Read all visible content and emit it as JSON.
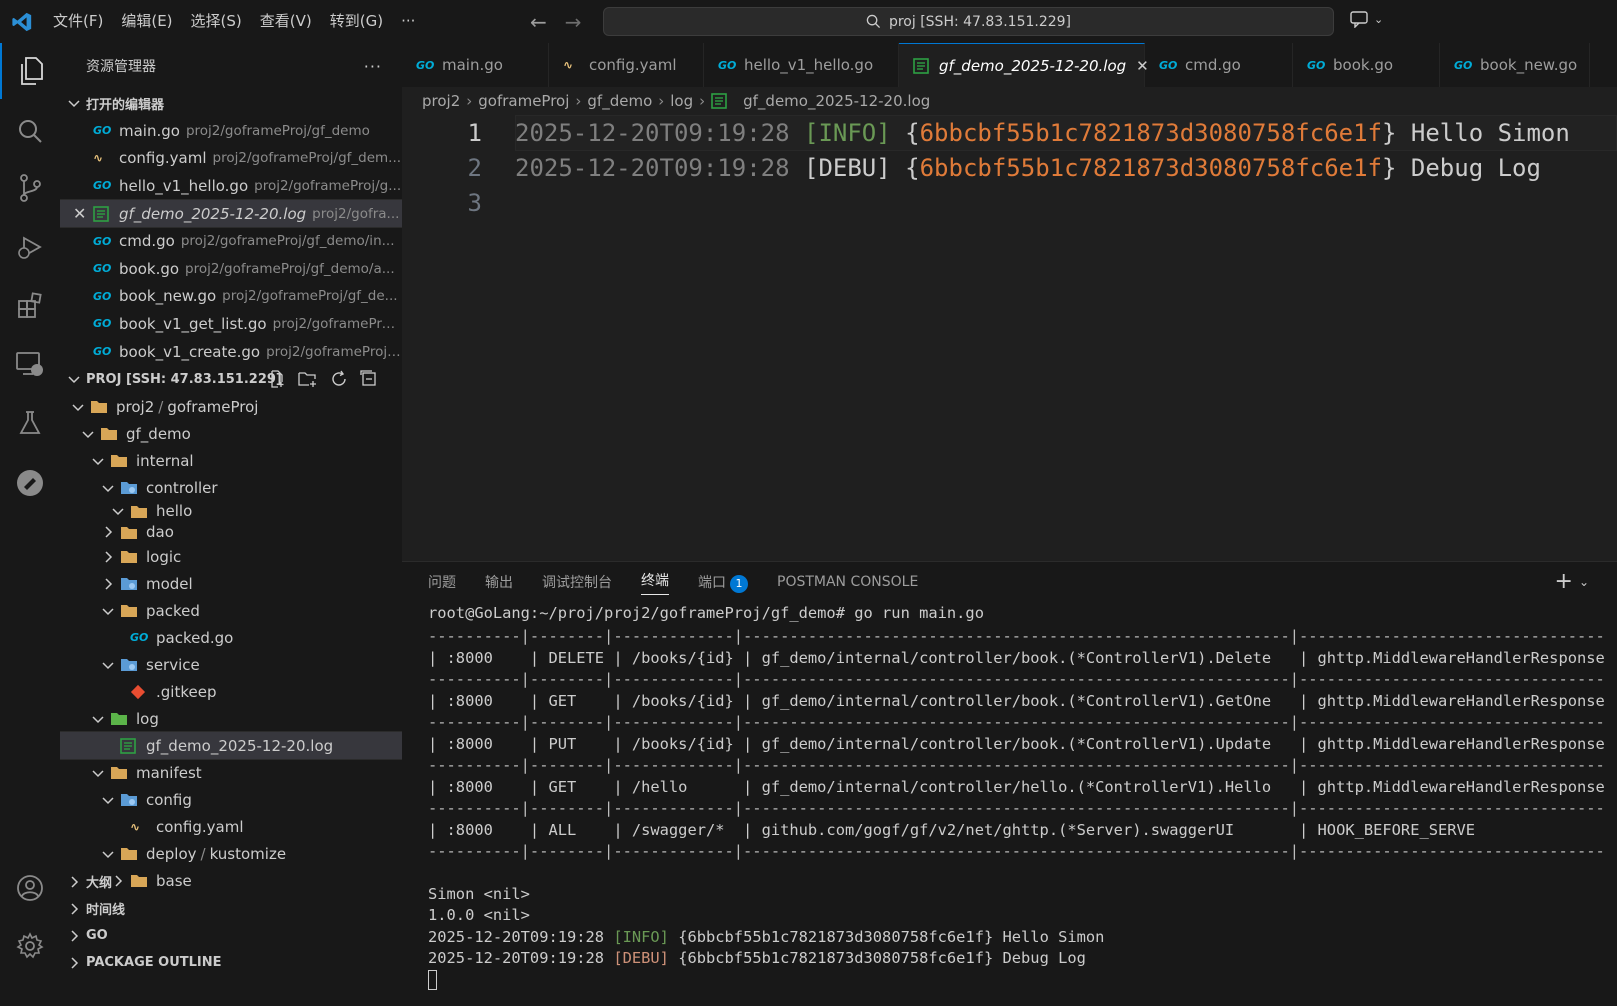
{
  "titlebar": {
    "menu": [
      "文件(F)",
      "编辑(E)",
      "选择(S)",
      "查看(V)",
      "转到(G)",
      "···"
    ],
    "search": "proj [SSH: 47.83.151.229]"
  },
  "activitybar": [
    "files-icon",
    "search-icon",
    "source-control-icon",
    "run-debug-icon",
    "extensions-icon",
    "remote-explorer-icon",
    "testing-icon",
    "goland-icon",
    "account-icon",
    "settings-icon"
  ],
  "sidebar": {
    "title": "资源管理器",
    "open_editors_title": "打开的编辑器",
    "open_editors": [
      {
        "name": "main.go",
        "path": "proj2/goframeProj/gf_demo",
        "icon": "go"
      },
      {
        "name": "config.yaml",
        "path": "proj2/goframeProj/gf_dem...",
        "icon": "yaml"
      },
      {
        "name": "hello_v1_hello.go",
        "path": "proj2/goframeProj/g...",
        "icon": "go"
      },
      {
        "name": "gf_demo_2025-12-20.log",
        "path": "proj2/gofra...",
        "icon": "log"
      },
      {
        "name": "cmd.go",
        "path": "proj2/goframeProj/gf_demo/in...",
        "icon": "go"
      },
      {
        "name": "book.go",
        "path": "proj2/goframeProj/gf_demo/a...",
        "icon": "go"
      },
      {
        "name": "book_new.go",
        "path": "proj2/goframeProj/gf_de...",
        "icon": "go"
      },
      {
        "name": "book_v1_get_list.go",
        "path": "proj2/goframePro...",
        "icon": "go"
      },
      {
        "name": "book_v1_create.go",
        "path": "proj2/goframeProj/...",
        " icon": "go"
      }
    ],
    "workspace_title": "PROJ [SSH: 47.83.151.229]",
    "tree": [
      {
        "name": "proj2",
        "suffix": "goframeProj",
        "depth": 0,
        "type": "folder-open"
      },
      {
        "name": "gf_demo",
        "depth": 1,
        "type": "folder-open"
      },
      {
        "name": "internal",
        "depth": 2,
        "type": "folder-open"
      },
      {
        "name": "controller",
        "depth": 3,
        "type": "folder-open-special"
      },
      {
        "name": "hello",
        "depth": 4,
        "type": "folder-open"
      },
      {
        "name": "dao",
        "depth": 3,
        "type": "folder"
      },
      {
        "name": "logic",
        "depth": 3,
        "type": "folder"
      },
      {
        "name": "model",
        "depth": 3,
        "type": "folder-special"
      },
      {
        "name": "packed",
        "depth": 3,
        "type": "folder-open"
      },
      {
        "name": "packed.go",
        "depth": 4,
        "type": "go"
      },
      {
        "name": "service",
        "depth": 3,
        "type": "folder-open-special"
      },
      {
        "name": ".gitkeep",
        "depth": 4,
        "type": "git"
      },
      {
        "name": "log",
        "depth": 2,
        "type": "folder-open-green"
      },
      {
        "name": "gf_demo_2025-12-20.log",
        "depth": 3,
        "type": "log"
      },
      {
        "name": "manifest",
        "depth": 2,
        "type": "folder-open"
      },
      {
        "name": "config",
        "depth": 3,
        "type": "folder-open-special"
      },
      {
        "name": "config.yaml",
        "depth": 4,
        "type": "yaml"
      },
      {
        "name": "deploy",
        "suffix": "kustomize",
        "depth": 3,
        "type": "folder-open"
      },
      {
        "name": "base",
        "depth": 4,
        "type": "folder"
      }
    ],
    "bottom_sections": [
      "大纲",
      "时间线",
      "GO",
      "PACKAGE OUTLINE"
    ]
  },
  "tabs": [
    {
      "label": "main.go",
      "icon": "go"
    },
    {
      "label": "config.yaml",
      "icon": "yaml"
    },
    {
      "label": "hello_v1_hello.go",
      "icon": "go"
    },
    {
      "label": "gf_demo_2025-12-20.log",
      "icon": "log",
      "active": true
    },
    {
      "label": "cmd.go",
      "icon": "go"
    },
    {
      "label": "book.go",
      "icon": "go"
    },
    {
      "label": "book_new.go",
      "icon": "go"
    }
  ],
  "breadcrumb": [
    "proj2",
    "goframeProj",
    "gf_demo",
    "log",
    "gf_demo_2025-12-20.log"
  ],
  "editor": {
    "lines": [
      {
        "n": "1",
        "ts": "2025-12-20T09:19:28",
        "level": "[INFO]",
        "id": "6bbcbf55b1c7821873d3080758fc6e1f",
        "msg": "Hello Simon"
      },
      {
        "n": "2",
        "ts": "2025-12-20T09:19:28",
        "level": "[DEBU]",
        "id": "6bbcbf55b1c7821873d3080758fc6e1f",
        "msg": "Debug Log"
      },
      {
        "n": "3"
      }
    ]
  },
  "panel": {
    "tabs": [
      "问题",
      "输出",
      "调试控制台",
      "终端",
      "端口",
      "POSTMAN CONSOLE"
    ],
    "ports_badge": "1",
    "terminal": {
      "prompt": "root@GoLang:~/proj/proj2/goframeProj/gf_demo# go run main.go",
      "separator": "----------|--------|-------------|-----------------------------------------------------------|---------------------------------",
      "rows": [
        "| :8000    | DELETE | /books/{id} | gf_demo/internal/controller/book.(*ControllerV1).Delete   | ghttp.MiddlewareHandlerResponse |",
        "| :8000    | GET    | /books/{id} | gf_demo/internal/controller/book.(*ControllerV1).GetOne   | ghttp.MiddlewareHandlerResponse |",
        "| :8000    | PUT    | /books/{id} | gf_demo/internal/controller/book.(*ControllerV1).Update   | ghttp.MiddlewareHandlerResponse |",
        "| :8000    | GET    | /hello      | gf_demo/internal/controller/hello.(*ControllerV1).Hello   | ghttp.MiddlewareHandlerResponse |",
        "| :8000    | ALL    | /swagger/*  | github.com/gogf/gf/v2/net/ghttp.(*Server).swaggerUI       | HOOK_BEFORE_SERVE               |"
      ],
      "out1": "Simon <nil>",
      "out2": "1.0.0 <nil>",
      "log1": {
        "ts": "2025-12-20T09:19:28 ",
        "level": "[INFO]",
        "rest": " {6bbcbf55b1c7821873d3080758fc6e1f} Hello Simon"
      },
      "log2": {
        "ts": "2025-12-20T09:19:28 ",
        "level": "[DEBU]",
        "rest": " {6bbcbf55b1c7821873d3080758fc6e1f} Debug Log"
      }
    }
  },
  "colors": {
    "accent": "#0078d4",
    "info": "#6a9955",
    "debu": "#ce9178",
    "hash": "#e07b39",
    "go": "#00acd7"
  }
}
